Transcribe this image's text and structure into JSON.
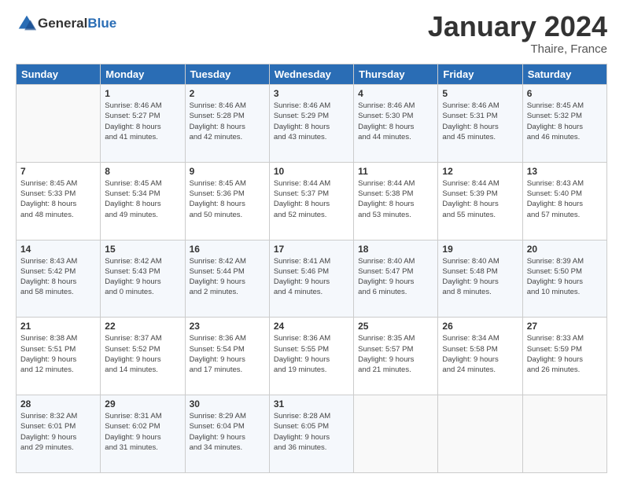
{
  "header": {
    "logo": {
      "general": "General",
      "blue": "Blue"
    },
    "title": "January 2024",
    "subtitle": "Thaire, France"
  },
  "weekdays": [
    "Sunday",
    "Monday",
    "Tuesday",
    "Wednesday",
    "Thursday",
    "Friday",
    "Saturday"
  ],
  "weeks": [
    [
      {
        "day": "",
        "sunrise": "",
        "sunset": "",
        "daylight": ""
      },
      {
        "day": "1",
        "sunrise": "Sunrise: 8:46 AM",
        "sunset": "Sunset: 5:27 PM",
        "daylight": "Daylight: 8 hours and 41 minutes."
      },
      {
        "day": "2",
        "sunrise": "Sunrise: 8:46 AM",
        "sunset": "Sunset: 5:28 PM",
        "daylight": "Daylight: 8 hours and 42 minutes."
      },
      {
        "day": "3",
        "sunrise": "Sunrise: 8:46 AM",
        "sunset": "Sunset: 5:29 PM",
        "daylight": "Daylight: 8 hours and 43 minutes."
      },
      {
        "day": "4",
        "sunrise": "Sunrise: 8:46 AM",
        "sunset": "Sunset: 5:30 PM",
        "daylight": "Daylight: 8 hours and 44 minutes."
      },
      {
        "day": "5",
        "sunrise": "Sunrise: 8:46 AM",
        "sunset": "Sunset: 5:31 PM",
        "daylight": "Daylight: 8 hours and 45 minutes."
      },
      {
        "day": "6",
        "sunrise": "Sunrise: 8:45 AM",
        "sunset": "Sunset: 5:32 PM",
        "daylight": "Daylight: 8 hours and 46 minutes."
      }
    ],
    [
      {
        "day": "7",
        "sunrise": "Sunrise: 8:45 AM",
        "sunset": "Sunset: 5:33 PM",
        "daylight": "Daylight: 8 hours and 48 minutes."
      },
      {
        "day": "8",
        "sunrise": "Sunrise: 8:45 AM",
        "sunset": "Sunset: 5:34 PM",
        "daylight": "Daylight: 8 hours and 49 minutes."
      },
      {
        "day": "9",
        "sunrise": "Sunrise: 8:45 AM",
        "sunset": "Sunset: 5:36 PM",
        "daylight": "Daylight: 8 hours and 50 minutes."
      },
      {
        "day": "10",
        "sunrise": "Sunrise: 8:44 AM",
        "sunset": "Sunset: 5:37 PM",
        "daylight": "Daylight: 8 hours and 52 minutes."
      },
      {
        "day": "11",
        "sunrise": "Sunrise: 8:44 AM",
        "sunset": "Sunset: 5:38 PM",
        "daylight": "Daylight: 8 hours and 53 minutes."
      },
      {
        "day": "12",
        "sunrise": "Sunrise: 8:44 AM",
        "sunset": "Sunset: 5:39 PM",
        "daylight": "Daylight: 8 hours and 55 minutes."
      },
      {
        "day": "13",
        "sunrise": "Sunrise: 8:43 AM",
        "sunset": "Sunset: 5:40 PM",
        "daylight": "Daylight: 8 hours and 57 minutes."
      }
    ],
    [
      {
        "day": "14",
        "sunrise": "Sunrise: 8:43 AM",
        "sunset": "Sunset: 5:42 PM",
        "daylight": "Daylight: 8 hours and 58 minutes."
      },
      {
        "day": "15",
        "sunrise": "Sunrise: 8:42 AM",
        "sunset": "Sunset: 5:43 PM",
        "daylight": "Daylight: 9 hours and 0 minutes."
      },
      {
        "day": "16",
        "sunrise": "Sunrise: 8:42 AM",
        "sunset": "Sunset: 5:44 PM",
        "daylight": "Daylight: 9 hours and 2 minutes."
      },
      {
        "day": "17",
        "sunrise": "Sunrise: 8:41 AM",
        "sunset": "Sunset: 5:46 PM",
        "daylight": "Daylight: 9 hours and 4 minutes."
      },
      {
        "day": "18",
        "sunrise": "Sunrise: 8:40 AM",
        "sunset": "Sunset: 5:47 PM",
        "daylight": "Daylight: 9 hours and 6 minutes."
      },
      {
        "day": "19",
        "sunrise": "Sunrise: 8:40 AM",
        "sunset": "Sunset: 5:48 PM",
        "daylight": "Daylight: 9 hours and 8 minutes."
      },
      {
        "day": "20",
        "sunrise": "Sunrise: 8:39 AM",
        "sunset": "Sunset: 5:50 PM",
        "daylight": "Daylight: 9 hours and 10 minutes."
      }
    ],
    [
      {
        "day": "21",
        "sunrise": "Sunrise: 8:38 AM",
        "sunset": "Sunset: 5:51 PM",
        "daylight": "Daylight: 9 hours and 12 minutes."
      },
      {
        "day": "22",
        "sunrise": "Sunrise: 8:37 AM",
        "sunset": "Sunset: 5:52 PM",
        "daylight": "Daylight: 9 hours and 14 minutes."
      },
      {
        "day": "23",
        "sunrise": "Sunrise: 8:36 AM",
        "sunset": "Sunset: 5:54 PM",
        "daylight": "Daylight: 9 hours and 17 minutes."
      },
      {
        "day": "24",
        "sunrise": "Sunrise: 8:36 AM",
        "sunset": "Sunset: 5:55 PM",
        "daylight": "Daylight: 9 hours and 19 minutes."
      },
      {
        "day": "25",
        "sunrise": "Sunrise: 8:35 AM",
        "sunset": "Sunset: 5:57 PM",
        "daylight": "Daylight: 9 hours and 21 minutes."
      },
      {
        "day": "26",
        "sunrise": "Sunrise: 8:34 AM",
        "sunset": "Sunset: 5:58 PM",
        "daylight": "Daylight: 9 hours and 24 minutes."
      },
      {
        "day": "27",
        "sunrise": "Sunrise: 8:33 AM",
        "sunset": "Sunset: 5:59 PM",
        "daylight": "Daylight: 9 hours and 26 minutes."
      }
    ],
    [
      {
        "day": "28",
        "sunrise": "Sunrise: 8:32 AM",
        "sunset": "Sunset: 6:01 PM",
        "daylight": "Daylight: 9 hours and 29 minutes."
      },
      {
        "day": "29",
        "sunrise": "Sunrise: 8:31 AM",
        "sunset": "Sunset: 6:02 PM",
        "daylight": "Daylight: 9 hours and 31 minutes."
      },
      {
        "day": "30",
        "sunrise": "Sunrise: 8:29 AM",
        "sunset": "Sunset: 6:04 PM",
        "daylight": "Daylight: 9 hours and 34 minutes."
      },
      {
        "day": "31",
        "sunrise": "Sunrise: 8:28 AM",
        "sunset": "Sunset: 6:05 PM",
        "daylight": "Daylight: 9 hours and 36 minutes."
      },
      {
        "day": "",
        "sunrise": "",
        "sunset": "",
        "daylight": ""
      },
      {
        "day": "",
        "sunrise": "",
        "sunset": "",
        "daylight": ""
      },
      {
        "day": "",
        "sunrise": "",
        "sunset": "",
        "daylight": ""
      }
    ]
  ]
}
